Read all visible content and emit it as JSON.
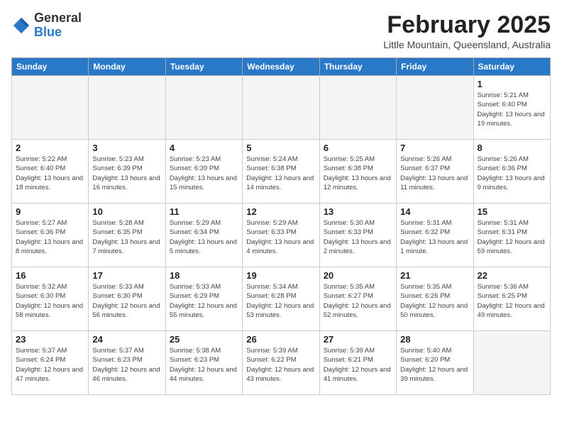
{
  "logo": {
    "general": "General",
    "blue": "Blue"
  },
  "header": {
    "title": "February 2025",
    "subtitle": "Little Mountain, Queensland, Australia"
  },
  "days_of_week": [
    "Sunday",
    "Monday",
    "Tuesday",
    "Wednesday",
    "Thursday",
    "Friday",
    "Saturday"
  ],
  "weeks": [
    [
      {
        "day": "",
        "info": "",
        "empty": true
      },
      {
        "day": "",
        "info": "",
        "empty": true
      },
      {
        "day": "",
        "info": "",
        "empty": true
      },
      {
        "day": "",
        "info": "",
        "empty": true
      },
      {
        "day": "",
        "info": "",
        "empty": true
      },
      {
        "day": "",
        "info": "",
        "empty": true
      },
      {
        "day": "1",
        "info": "Sunrise: 5:21 AM\nSunset: 6:40 PM\nDaylight: 13 hours and 19 minutes."
      }
    ],
    [
      {
        "day": "2",
        "info": "Sunrise: 5:22 AM\nSunset: 6:40 PM\nDaylight: 13 hours and 18 minutes."
      },
      {
        "day": "3",
        "info": "Sunrise: 5:23 AM\nSunset: 6:39 PM\nDaylight: 13 hours and 16 minutes."
      },
      {
        "day": "4",
        "info": "Sunrise: 5:23 AM\nSunset: 6:39 PM\nDaylight: 13 hours and 15 minutes."
      },
      {
        "day": "5",
        "info": "Sunrise: 5:24 AM\nSunset: 6:38 PM\nDaylight: 13 hours and 14 minutes."
      },
      {
        "day": "6",
        "info": "Sunrise: 5:25 AM\nSunset: 6:38 PM\nDaylight: 13 hours and 12 minutes."
      },
      {
        "day": "7",
        "info": "Sunrise: 5:26 AM\nSunset: 6:37 PM\nDaylight: 13 hours and 11 minutes."
      },
      {
        "day": "8",
        "info": "Sunrise: 5:26 AM\nSunset: 6:36 PM\nDaylight: 13 hours and 9 minutes."
      }
    ],
    [
      {
        "day": "9",
        "info": "Sunrise: 5:27 AM\nSunset: 6:36 PM\nDaylight: 13 hours and 8 minutes."
      },
      {
        "day": "10",
        "info": "Sunrise: 5:28 AM\nSunset: 6:35 PM\nDaylight: 13 hours and 7 minutes."
      },
      {
        "day": "11",
        "info": "Sunrise: 5:29 AM\nSunset: 6:34 PM\nDaylight: 13 hours and 5 minutes."
      },
      {
        "day": "12",
        "info": "Sunrise: 5:29 AM\nSunset: 6:33 PM\nDaylight: 13 hours and 4 minutes."
      },
      {
        "day": "13",
        "info": "Sunrise: 5:30 AM\nSunset: 6:33 PM\nDaylight: 13 hours and 2 minutes."
      },
      {
        "day": "14",
        "info": "Sunrise: 5:31 AM\nSunset: 6:32 PM\nDaylight: 13 hours and 1 minute."
      },
      {
        "day": "15",
        "info": "Sunrise: 5:31 AM\nSunset: 6:31 PM\nDaylight: 12 hours and 59 minutes."
      }
    ],
    [
      {
        "day": "16",
        "info": "Sunrise: 5:32 AM\nSunset: 6:30 PM\nDaylight: 12 hours and 58 minutes."
      },
      {
        "day": "17",
        "info": "Sunrise: 5:33 AM\nSunset: 6:30 PM\nDaylight: 12 hours and 56 minutes."
      },
      {
        "day": "18",
        "info": "Sunrise: 5:33 AM\nSunset: 6:29 PM\nDaylight: 12 hours and 55 minutes."
      },
      {
        "day": "19",
        "info": "Sunrise: 5:34 AM\nSunset: 6:28 PM\nDaylight: 12 hours and 53 minutes."
      },
      {
        "day": "20",
        "info": "Sunrise: 5:35 AM\nSunset: 6:27 PM\nDaylight: 12 hours and 52 minutes."
      },
      {
        "day": "21",
        "info": "Sunrise: 5:35 AM\nSunset: 6:26 PM\nDaylight: 12 hours and 50 minutes."
      },
      {
        "day": "22",
        "info": "Sunrise: 5:36 AM\nSunset: 6:25 PM\nDaylight: 12 hours and 49 minutes."
      }
    ],
    [
      {
        "day": "23",
        "info": "Sunrise: 5:37 AM\nSunset: 6:24 PM\nDaylight: 12 hours and 47 minutes."
      },
      {
        "day": "24",
        "info": "Sunrise: 5:37 AM\nSunset: 6:23 PM\nDaylight: 12 hours and 46 minutes."
      },
      {
        "day": "25",
        "info": "Sunrise: 5:38 AM\nSunset: 6:23 PM\nDaylight: 12 hours and 44 minutes."
      },
      {
        "day": "26",
        "info": "Sunrise: 5:39 AM\nSunset: 6:22 PM\nDaylight: 12 hours and 43 minutes."
      },
      {
        "day": "27",
        "info": "Sunrise: 5:39 AM\nSunset: 6:21 PM\nDaylight: 12 hours and 41 minutes."
      },
      {
        "day": "28",
        "info": "Sunrise: 5:40 AM\nSunset: 6:20 PM\nDaylight: 12 hours and 39 minutes."
      },
      {
        "day": "",
        "info": "",
        "empty": true
      }
    ]
  ]
}
